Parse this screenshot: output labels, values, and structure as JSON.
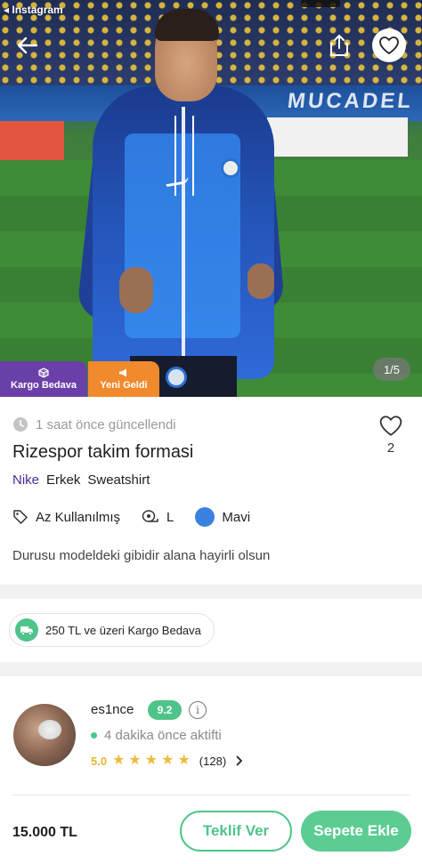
{
  "status_bar": {
    "back_app": "◂ Instagram"
  },
  "hero": {
    "banner_text": "MUCADEL",
    "badges": {
      "kargo": "Kargo Bedava",
      "yeni": "Yeni Geldi"
    },
    "image_counter": "1/5"
  },
  "product": {
    "updated": "1 saat önce güncellendi",
    "title": "Rizespor takim formasi",
    "likes": "2",
    "brand": "Nike",
    "gender": "Erkek",
    "category": "Sweatshirt",
    "condition": "Az Kullanılmış",
    "size": "L",
    "color_name": "Mavi",
    "color_hex": "#3b82e0",
    "description": "Durusu modeldeki gibidir alana hayirli olsun"
  },
  "shipping": {
    "pill": "250 TL ve üzeri Kargo Bedava"
  },
  "seller": {
    "name": "es1nce",
    "score": "9.2",
    "active": "4 dakika önce aktifti",
    "rating": "5.0",
    "review_count": "(128)"
  },
  "footer": {
    "price": "15.000 TL",
    "offer_label": "Teklif Ver",
    "cart_label": "Sepete Ekle"
  },
  "colors": {
    "accent_green": "#4fc48a",
    "brand_purple": "#6a3fa8",
    "orange": "#f08a2c"
  },
  "icons": [
    "back-arrow-icon",
    "share-icon",
    "heart-icon",
    "box-icon",
    "megaphone-icon",
    "clock-icon",
    "tag-icon",
    "measure-tape-icon",
    "truck-icon",
    "info-icon",
    "star-icon",
    "chevron-right-icon"
  ]
}
